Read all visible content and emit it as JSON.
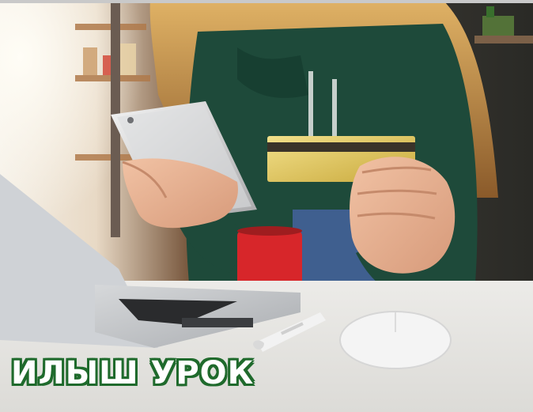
{
  "caption": {
    "text": "ИЛЫШ УРОК"
  }
}
